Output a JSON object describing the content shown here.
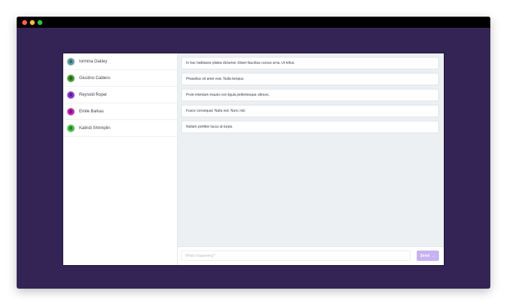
{
  "window": {
    "background_color": "#342455",
    "titlebar_color": "#000000",
    "controls": [
      "close",
      "minimize",
      "maximize"
    ]
  },
  "sidebar": {
    "contacts": [
      {
        "name": "Iormina Oakley",
        "avatar_color": "#5aa0a6"
      },
      {
        "name": "Giustino Caldero",
        "avatar_color": "#3c9b28"
      },
      {
        "name": "Reynold Roper",
        "avatar_color": "#8a33d6"
      },
      {
        "name": "Emile Barkas",
        "avatar_color": "#c51fb4"
      },
      {
        "name": "Kalindi Shrimplin",
        "avatar_color": "#3cc243"
      }
    ]
  },
  "chat": {
    "messages": [
      "In hac habitasse platea dictumst. Etiam faucibus cursus urna. Ut tellus.",
      "Phasellus sit amet erat. Nulla tempus.",
      "Proin interdum mauris non ligula pellentesque ultrices.",
      "Fusce consequat. Nulla nisl. Nunc nisl.",
      "Nullam porttitor lacus at turpis."
    ],
    "composer": {
      "placeholder": "What's happening?",
      "value": "",
      "send_label": "Send",
      "send_icon": "arrow-right-icon",
      "send_color": "#c9b2f2"
    }
  }
}
